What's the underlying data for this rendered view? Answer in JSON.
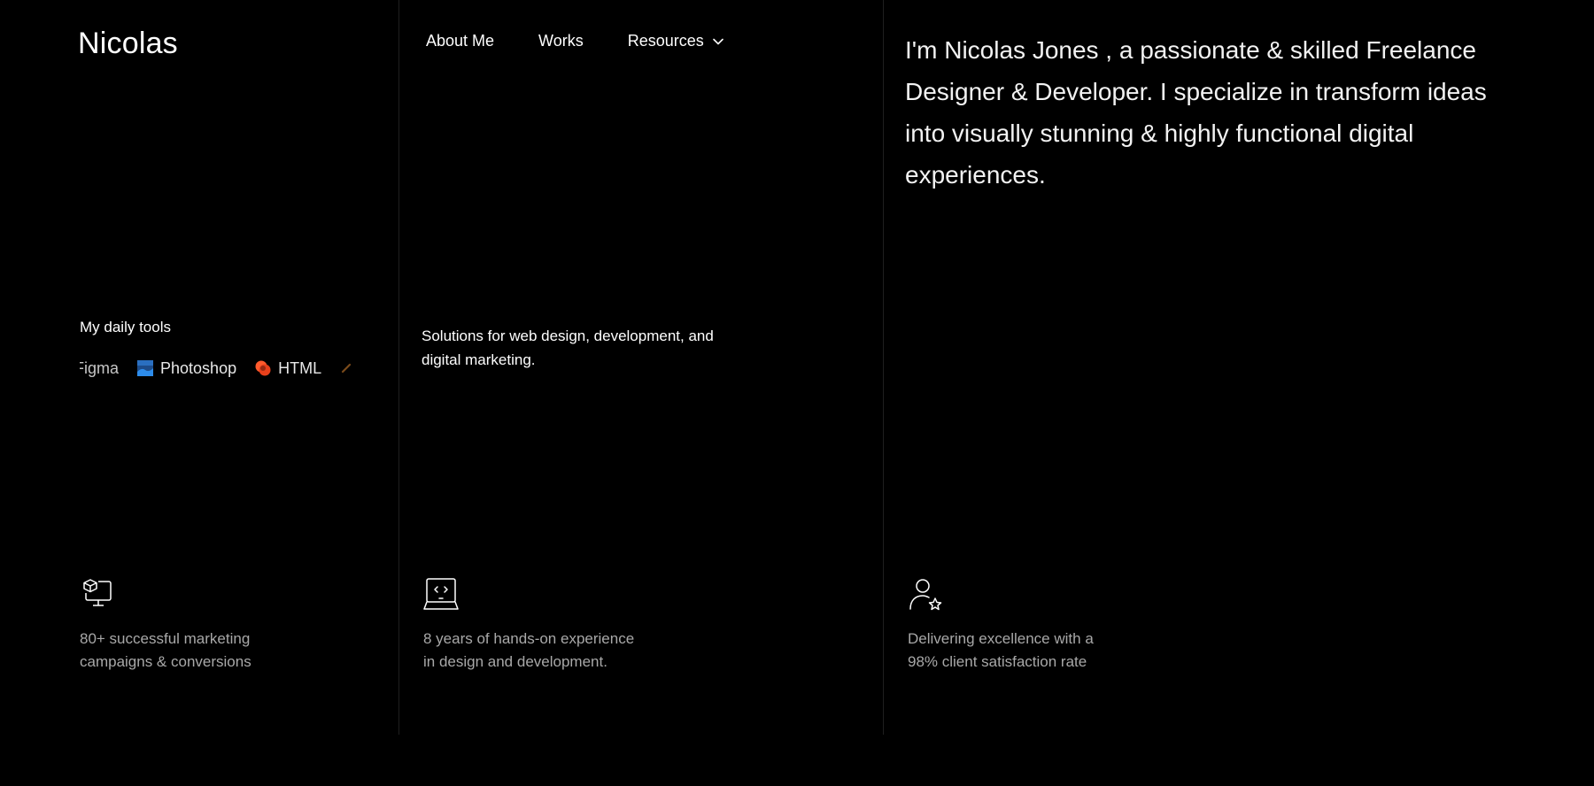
{
  "header": {
    "logo": "Nicolas",
    "nav": [
      {
        "label": "About Me"
      },
      {
        "label": "Works"
      },
      {
        "label": "Resources",
        "has_dropdown": true
      }
    ]
  },
  "intro": {
    "text": "I'm Nicolas Jones , a passionate & skilled Freelance Designer & Developer. I specialize in transform ideas into visually stunning & highly functional digital experiences."
  },
  "tools": {
    "heading": "My daily tools",
    "items": [
      {
        "label": "Figma",
        "icon": "figma-icon"
      },
      {
        "label": "Photoshop",
        "icon": "photoshop-icon",
        "color": "#2d8ceb"
      },
      {
        "label": "HTML",
        "icon": "html-icon",
        "color": "#ff5a2c"
      }
    ]
  },
  "solutions": {
    "text": "Solutions for web design, development, and digital marketing."
  },
  "stats": [
    {
      "icon": "monitor-box-icon",
      "line1": "80+ successful marketing",
      "line2": "campaigns & conversions"
    },
    {
      "icon": "laptop-code-icon",
      "line1": "8 years of hands-on experience",
      "line2": "in design and development."
    },
    {
      "icon": "user-star-icon",
      "line1": "Delivering excellence with a",
      "line2": "98% client satisfaction rate"
    }
  ],
  "colors": {
    "background": "#000000",
    "text": "#ffffff",
    "muted_text": "#a8a8a8",
    "divider": "#1f1f1f"
  }
}
